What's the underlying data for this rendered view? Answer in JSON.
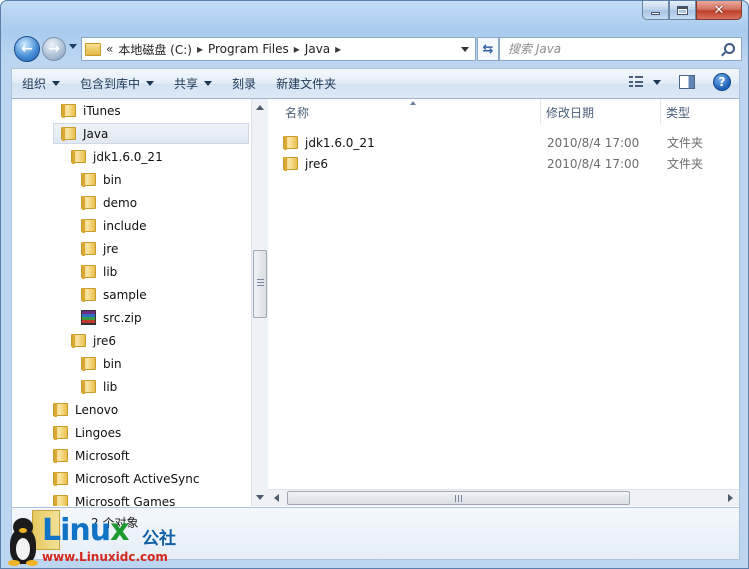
{
  "address": {
    "overflow_glyph": "«",
    "breadcrumbs": [
      "本地磁盘 (C:)",
      "Program Files",
      "Java"
    ],
    "separator": "▸"
  },
  "search": {
    "placeholder": "搜索 Java"
  },
  "toolbar": {
    "organize": "组织",
    "include_in_library": "包含到库中",
    "share": "共享",
    "burn": "刻录",
    "new_folder": "新建文件夹",
    "help": "?"
  },
  "nav_tree": [
    {
      "label": "iTunes",
      "icon": "folder-icon"
    },
    {
      "label": "Java",
      "icon": "folder-icon",
      "selected": true
    },
    {
      "label": "jdk1.6.0_21",
      "icon": "folder-icon"
    },
    {
      "label": "bin",
      "icon": "folder-icon"
    },
    {
      "label": "demo",
      "icon": "folder-icon"
    },
    {
      "label": "include",
      "icon": "folder-icon"
    },
    {
      "label": "jre",
      "icon": "folder-icon"
    },
    {
      "label": "lib",
      "icon": "folder-icon"
    },
    {
      "label": "sample",
      "icon": "folder-icon"
    },
    {
      "label": "src.zip",
      "icon": "archive-icon"
    },
    {
      "label": "jre6",
      "icon": "folder-icon"
    },
    {
      "label": "bin",
      "icon": "folder-icon"
    },
    {
      "label": "lib",
      "icon": "folder-icon"
    },
    {
      "label": "Lenovo",
      "icon": "folder-icon"
    },
    {
      "label": "Lingoes",
      "icon": "folder-icon"
    },
    {
      "label": "Microsoft",
      "icon": "folder-icon"
    },
    {
      "label": "Microsoft ActiveSync",
      "icon": "folder-icon"
    },
    {
      "label": "Microsoft Games",
      "icon": "folder-icon"
    }
  ],
  "columns": {
    "name": "名称",
    "modified": "修改日期",
    "type": "类型"
  },
  "files": [
    {
      "name": "jdk1.6.0_21",
      "modified": "2010/8/4 17:00",
      "type": "文件夹"
    },
    {
      "name": "jre6",
      "modified": "2010/8/4 17:00",
      "type": "文件夹"
    }
  ],
  "status": {
    "item_count": "2 个对象"
  },
  "watermark": {
    "logo_main": "Linu",
    "logo_x": "x",
    "logo_cn": "公社",
    "url": "www.Linuxidc.com"
  },
  "colors": {
    "accent": "#1b5fb6",
    "window_frame": "#bcd6f2",
    "selection": "#e1e8f1"
  }
}
